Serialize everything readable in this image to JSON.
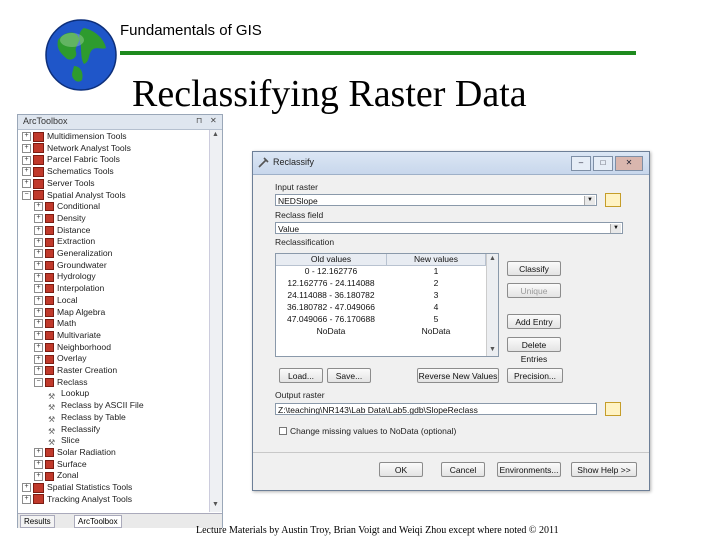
{
  "header": {
    "course": "Fundamentals of GIS",
    "title": "Reclassifying Raster Data",
    "footer": "Lecture Materials by Austin Troy, Brian Voigt and Weiqi Zhou except where noted © 2011"
  },
  "colors": {
    "rule": "#1e8a1e",
    "toolbox_icon": "#c0392b"
  },
  "toolbox": {
    "title": "ArcToolbox",
    "items": [
      {
        "label": "Multidimension Tools",
        "kind": "toolbox",
        "expanded": false
      },
      {
        "label": "Network Analyst Tools",
        "kind": "toolbox",
        "expanded": false
      },
      {
        "label": "Parcel Fabric Tools",
        "kind": "toolbox",
        "expanded": false
      },
      {
        "label": "Schematics Tools",
        "kind": "toolbox",
        "expanded": false
      },
      {
        "label": "Server Tools",
        "kind": "toolbox",
        "expanded": false
      },
      {
        "label": "Spatial Analyst Tools",
        "kind": "toolbox",
        "expanded": true
      },
      {
        "label": "Conditional",
        "kind": "toolset",
        "expanded": false
      },
      {
        "label": "Density",
        "kind": "toolset",
        "expanded": false
      },
      {
        "label": "Distance",
        "kind": "toolset",
        "expanded": false
      },
      {
        "label": "Extraction",
        "kind": "toolset",
        "expanded": false
      },
      {
        "label": "Generalization",
        "kind": "toolset",
        "expanded": false
      },
      {
        "label": "Groundwater",
        "kind": "toolset",
        "expanded": false
      },
      {
        "label": "Hydrology",
        "kind": "toolset",
        "expanded": false
      },
      {
        "label": "Interpolation",
        "kind": "toolset",
        "expanded": false
      },
      {
        "label": "Local",
        "kind": "toolset",
        "expanded": false
      },
      {
        "label": "Map Algebra",
        "kind": "toolset",
        "expanded": false
      },
      {
        "label": "Math",
        "kind": "toolset",
        "expanded": false
      },
      {
        "label": "Multivariate",
        "kind": "toolset",
        "expanded": false
      },
      {
        "label": "Neighborhood",
        "kind": "toolset",
        "expanded": false
      },
      {
        "label": "Overlay",
        "kind": "toolset",
        "expanded": false
      },
      {
        "label": "Raster Creation",
        "kind": "toolset",
        "expanded": false
      },
      {
        "label": "Reclass",
        "kind": "toolset",
        "expanded": true
      },
      {
        "label": "Lookup",
        "kind": "tool"
      },
      {
        "label": "Reclass by ASCII File",
        "kind": "tool"
      },
      {
        "label": "Reclass by Table",
        "kind": "tool"
      },
      {
        "label": "Reclassify",
        "kind": "tool"
      },
      {
        "label": "Slice",
        "kind": "tool"
      },
      {
        "label": "Solar Radiation",
        "kind": "toolset",
        "expanded": false
      },
      {
        "label": "Surface",
        "kind": "toolset",
        "expanded": false
      },
      {
        "label": "Zonal",
        "kind": "toolset",
        "expanded": false
      },
      {
        "label": "Spatial Statistics Tools",
        "kind": "toolbox",
        "expanded": false
      },
      {
        "label": "Tracking Analyst Tools",
        "kind": "toolbox",
        "expanded": false
      }
    ],
    "tabs": [
      "Results",
      "ArcToolbox"
    ]
  },
  "dialog": {
    "title": "Reclassify",
    "input_raster_label": "Input raster",
    "input_raster_value": "NEDSlope",
    "reclass_field_label": "Reclass field",
    "reclass_field_value": "Value",
    "reclassification_label": "Reclassification",
    "columns": [
      "Old values",
      "New values"
    ],
    "rows": [
      [
        "0 - 12.162776",
        "1"
      ],
      [
        "12.162776 - 24.114088",
        "2"
      ],
      [
        "24.114088 - 36.180782",
        "3"
      ],
      [
        "36.180782 - 47.049066",
        "4"
      ],
      [
        "47.049066 - 76.170688",
        "5"
      ],
      [
        "NoData",
        "NoData"
      ]
    ],
    "buttons_side": [
      "Classify",
      "Unique",
      "Add Entry",
      "Delete Entries"
    ],
    "buttons_bottom": [
      "Load...",
      "Save...",
      "Reverse New Values",
      "Precision..."
    ],
    "output_raster_label": "Output raster",
    "output_raster_value": "Z:\\teaching\\NR143\\Lab Data\\Lab5.gdb\\SlopeReclass",
    "checkbox_label": "Change missing values to NoData (optional)",
    "footer_buttons": [
      "OK",
      "Cancel",
      "Environments...",
      "Show Help >>"
    ]
  }
}
